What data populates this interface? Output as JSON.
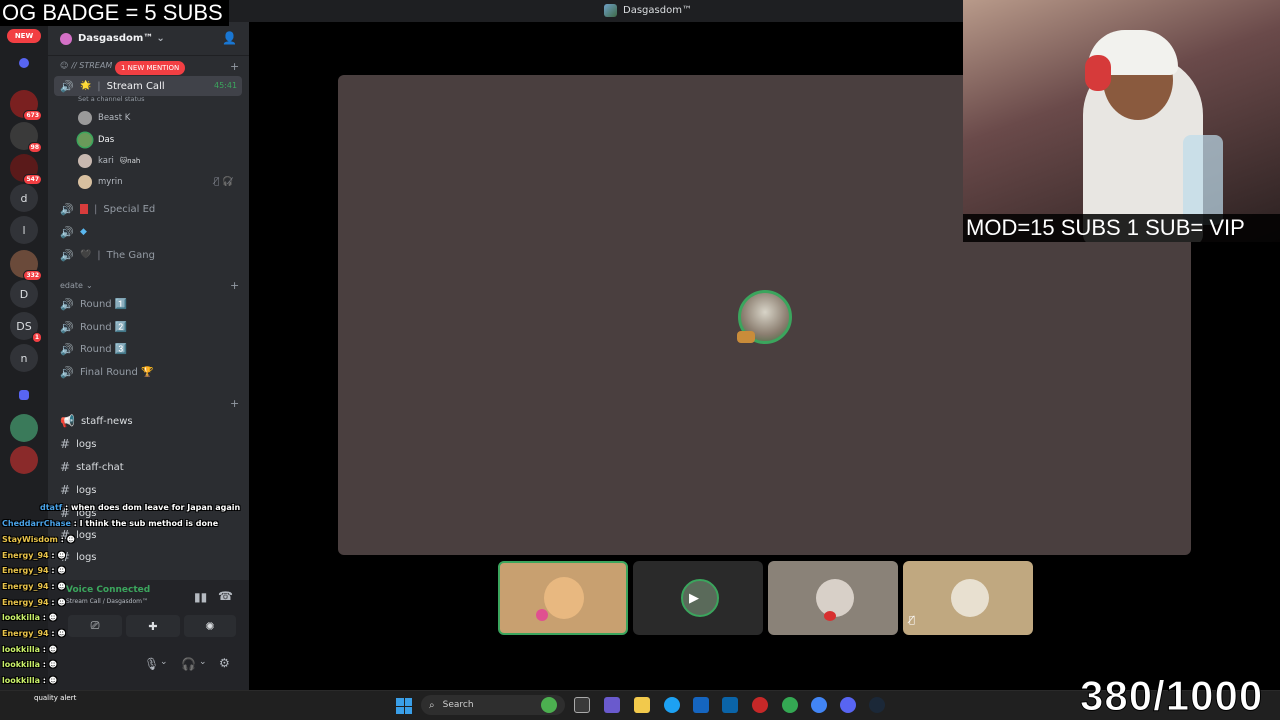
{
  "window": {
    "title": "Dasgasdom™"
  },
  "overlay": {
    "top_banner": "OG BADGE = 5 SUBS",
    "webcam_caption": "MOD=15 SUBS  1 SUB= VIP",
    "sub_counter": "380/1000"
  },
  "rail": {
    "new_label": "NEW",
    "items": [
      {
        "label": "",
        "badge": ""
      },
      {
        "label": "",
        "badge": "673"
      },
      {
        "label": "",
        "badge": "98"
      },
      {
        "label": "",
        "badge": "547"
      },
      {
        "label": "d",
        "badge": ""
      },
      {
        "label": "l",
        "badge": ""
      },
      {
        "label": "",
        "badge": "332"
      },
      {
        "label": "D",
        "badge": ""
      },
      {
        "label": "DS",
        "badge": "1"
      },
      {
        "label": "n",
        "badge": ""
      }
    ]
  },
  "server": {
    "name": "Dasgasdom™"
  },
  "sidebar": {
    "category_stream": "// STREAM",
    "new_mention": "1 NEW MENTION",
    "active_channel": "Stream Call",
    "active_channel_timer": "45:41",
    "channel_status": "Set a channel status",
    "users": [
      {
        "name": "Beast K",
        "suffix": ""
      },
      {
        "name": "Das",
        "suffix": ""
      },
      {
        "name": "kari",
        "suffix": "🐱nah"
      },
      {
        "name": "myrin",
        "suffix": ""
      }
    ],
    "voice_channels": [
      "Special Ed",
      "",
      "The Gang"
    ],
    "category_edate": "edate",
    "rounds": [
      "Round 1️⃣",
      "Round 2️⃣",
      "Round 3️⃣",
      "Final Round 🏆"
    ],
    "text_channels": [
      "staff-news",
      "logs",
      "staff-chat",
      "logs",
      "logs",
      "logs",
      "logs"
    ]
  },
  "voice": {
    "status": "Voice Connected",
    "location": "Stream Call / Dasgasdom™"
  },
  "chat": [
    {
      "user": "dtatf",
      "text": "when does dom leave for Japan again",
      "color": "blue"
    },
    {
      "user": "CheddarrChase",
      "text": "I think the sub method is done",
      "color": "blue"
    },
    {
      "user": "StayWisdom",
      "text": "",
      "color": ""
    },
    {
      "user": "Energy_94",
      "text": "",
      "color": ""
    },
    {
      "user": "Energy_94",
      "text": "",
      "color": ""
    },
    {
      "user": "Energy_94",
      "text": "",
      "color": ""
    },
    {
      "user": "lookkilla",
      "text": "",
      "color": "green"
    },
    {
      "user": "Energy_94",
      "text": "",
      "color": ""
    },
    {
      "user": "lookkilla",
      "text": "",
      "color": "green"
    },
    {
      "user": "lookkilla",
      "text": "",
      "color": "green"
    },
    {
      "user": "lookkilla",
      "text": "",
      "color": "green"
    }
  ],
  "taskbar": {
    "search_placeholder": "Search",
    "quality_alert": "quality alert"
  },
  "colors": {
    "accent_green": "#3ba55d",
    "mention_red": "#f23f43",
    "stage_bg": "#4a3f3f"
  }
}
